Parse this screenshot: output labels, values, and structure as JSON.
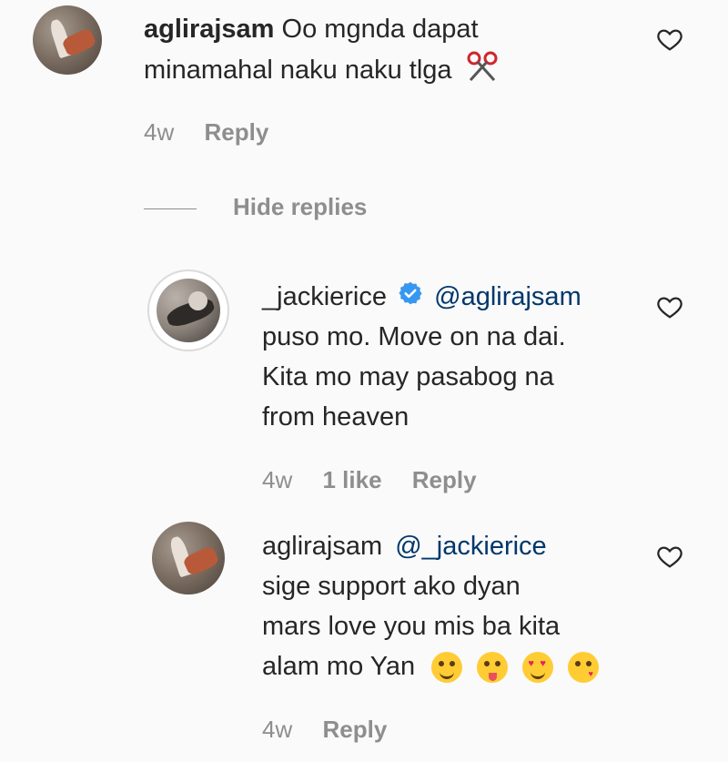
{
  "comments": [
    {
      "username": "aglirajsam",
      "text_line1": "Oo mgnda dapat",
      "text_line2": "minamahal naku naku tlga",
      "trailing_icon": "scissors-icon",
      "age": "4w",
      "reply_label": "Reply"
    }
  ],
  "hide_replies_label": "Hide replies",
  "replies": [
    {
      "username": "_jackierice",
      "verified": true,
      "mention": "@aglirajsam",
      "lines": [
        "puso mo. Move on na dai.",
        "Kita mo may pasabog na",
        "from heaven"
      ],
      "age": "4w",
      "likes": "1 like",
      "reply_label": "Reply"
    },
    {
      "username": "aglirajsam",
      "mention": "@_jackierice",
      "lines": [
        "sige support ako dyan",
        "mars love you mis ba kita",
        "alam mo Yan"
      ],
      "emojis": [
        "yum-face-icon",
        "tongue-wink-face-icon",
        "heart-eyes-face-icon",
        "kiss-wink-face-icon"
      ],
      "age": "4w",
      "reply_label": "Reply"
    }
  ],
  "colors": {
    "background": "#fafafa",
    "text": "#262626",
    "secondary": "#8e8e8e",
    "mention": "#00376b",
    "verified": "#3897f0"
  }
}
